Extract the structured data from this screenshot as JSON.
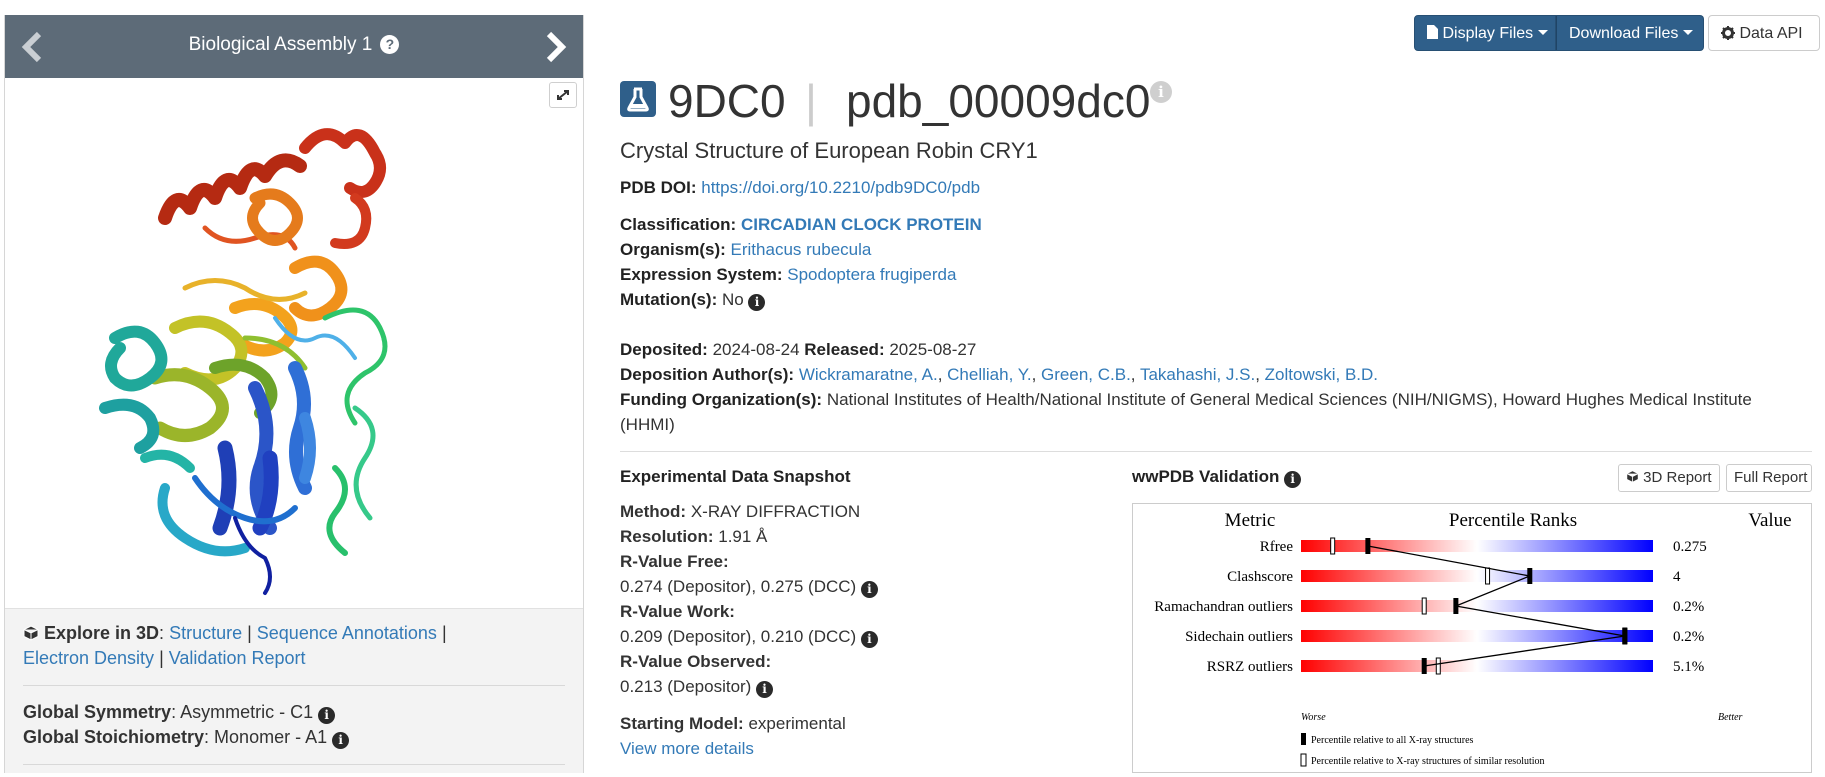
{
  "left_panel": {
    "assembly_title": "Biological Assembly 1",
    "explore_label": "Explore in 3D",
    "explore_links": [
      "Structure",
      "Sequence Annotations",
      "Electron Density",
      "Validation Report"
    ],
    "global_symmetry_label": "Global Symmetry",
    "global_symmetry_value": "Asymmetric - C1",
    "global_stoichiometry_label": "Global Stoichiometry",
    "global_stoichiometry_value": "Monomer - A1"
  },
  "toolbar": {
    "display_files": "Display Files",
    "download_files": "Download Files",
    "data_api": "Data API"
  },
  "entry": {
    "id": "9DC0",
    "separator": "|",
    "extended_id": "pdb_00009dc0",
    "title": "Crystal Structure of European Robin CRY1",
    "doi_label": "PDB DOI:",
    "doi_value": "https://doi.org/10.2210/pdb9DC0/pdb",
    "classification_label": "Classification:",
    "classification_value": "CIRCADIAN CLOCK PROTEIN",
    "organism_label": "Organism(s):",
    "organism_value": "Erithacus rubecula",
    "expression_label": "Expression System:",
    "expression_value": "Spodoptera frugiperda",
    "mutation_label": "Mutation(s):",
    "mutation_value": "No",
    "deposited_label": "Deposited:",
    "deposited_value": "2024-08-24",
    "released_label": "Released:",
    "released_value": "2025-08-27",
    "authors_label": "Deposition Author(s):",
    "authors": [
      "Wickramaratne, A.",
      "Chelliah, Y.",
      "Green, C.B.",
      "Takahashi, J.S.",
      "Zoltowski, B.D."
    ],
    "funding_label": "Funding Organization(s):",
    "funding_line1": "National Institutes of Health/National Institute of General Medical Sciences (NIH/NIGMS), Howard Hughes Medical Institute",
    "funding_line2": "(HHMI)"
  },
  "snapshot": {
    "title": "Experimental Data Snapshot",
    "method_label": "Method:",
    "method_value": "X-RAY DIFFRACTION",
    "resolution_label": "Resolution:",
    "resolution_value": "1.91 Å",
    "rfree_label": "R-Value Free:",
    "rfree_value": "0.274 (Depositor), 0.275 (DCC)",
    "rwork_label": "R-Value Work:",
    "rwork_value": "0.209 (Depositor), 0.210 (DCC)",
    "robs_label": "R-Value Observed:",
    "robs_value": "0.213 (Depositor)",
    "starting_model_label": "Starting Model:",
    "starting_model_value": "experimental",
    "view_more": "View more details"
  },
  "validation": {
    "title": "wwPDB Validation",
    "report_3d": "3D Report",
    "full_report": "Full Report",
    "header_metric": "Metric",
    "header_ranks": "Percentile Ranks",
    "header_value": "Value",
    "worse": "Worse",
    "better": "Better",
    "legend_all": "Percentile relative to all X-ray structures",
    "legend_similar": "Percentile relative to X-ray structures of similar resolution",
    "metrics": [
      {
        "name": "Rfree",
        "value": "0.275",
        "pct_all": 19,
        "pct_similar": 9
      },
      {
        "name": "Clashscore",
        "value": "4",
        "pct_all": 65,
        "pct_similar": 53
      },
      {
        "name": "Ramachandran outliers",
        "value": "0.2%",
        "pct_all": 44,
        "pct_similar": 35
      },
      {
        "name": "Sidechain outliers",
        "value": "0.2%",
        "pct_all": 92,
        "pct_similar": 92
      },
      {
        "name": "RSRZ outliers",
        "value": "5.1%",
        "pct_all": 35,
        "pct_similar": 39
      }
    ]
  },
  "colors": {
    "header_bg": "#5d6b78",
    "brand_blue": "#2f5f8a",
    "link": "#337ab7",
    "worse": "#ff0000",
    "better": "#0000ff"
  },
  "icons": [
    "chevron-left-icon",
    "chevron-right-icon",
    "question-icon",
    "expand-icon",
    "cube-icon",
    "info-icon",
    "file-icon",
    "gear-icon",
    "flask-icon"
  ]
}
